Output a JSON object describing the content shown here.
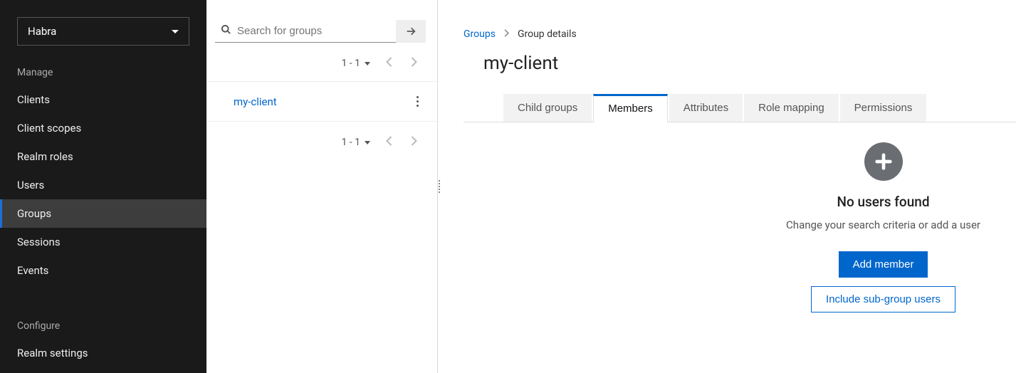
{
  "sidebar": {
    "realm": "Habra",
    "section_manage": "Manage",
    "section_configure": "Configure",
    "items": [
      {
        "label": "Clients"
      },
      {
        "label": "Client scopes"
      },
      {
        "label": "Realm roles"
      },
      {
        "label": "Users"
      },
      {
        "label": "Groups"
      },
      {
        "label": "Sessions"
      },
      {
        "label": "Events"
      }
    ],
    "configure_items": [
      {
        "label": "Realm settings"
      }
    ]
  },
  "middle": {
    "search_placeholder": "Search for groups",
    "pager_top": "1 - 1",
    "pager_bottom": "1 - 1",
    "groups": [
      {
        "name": "my-client"
      }
    ]
  },
  "main": {
    "breadcrumb_root": "Groups",
    "breadcrumb_current": "Group details",
    "title": "my-client",
    "tabs": [
      {
        "label": "Child groups"
      },
      {
        "label": "Members"
      },
      {
        "label": "Attributes"
      },
      {
        "label": "Role mapping"
      },
      {
        "label": "Permissions"
      }
    ],
    "empty": {
      "title": "No users found",
      "desc": "Change your search criteria or add a user",
      "primary": "Add member",
      "secondary": "Include sub-group users"
    }
  }
}
